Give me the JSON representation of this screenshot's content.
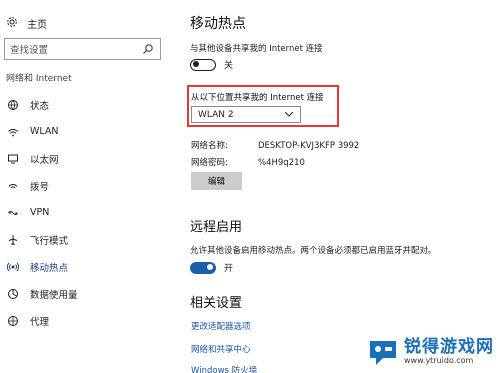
{
  "sidebar": {
    "home_label": "主页",
    "search_placeholder": "查找设置",
    "section_title": "网络和 Internet",
    "items": [
      {
        "label": "状态",
        "icon": "globe-status-icon",
        "active": false
      },
      {
        "label": "WLAN",
        "icon": "wifi-icon",
        "active": false
      },
      {
        "label": "以太网",
        "icon": "ethernet-monitor-icon",
        "active": false
      },
      {
        "label": "拨号",
        "icon": "dialup-icon",
        "active": false
      },
      {
        "label": "VPN",
        "icon": "vpn-icon",
        "active": false
      },
      {
        "label": "飞行模式",
        "icon": "airplane-icon",
        "active": false
      },
      {
        "label": "移动热点",
        "icon": "hotspot-icon",
        "active": true
      },
      {
        "label": "数据使用量",
        "icon": "data-usage-icon",
        "active": false
      },
      {
        "label": "代理",
        "icon": "proxy-globe-icon",
        "active": false
      }
    ]
  },
  "main": {
    "title": "移动热点",
    "share_desc": "与其他设备共享我的 Internet 连接",
    "hotspot_toggle_label": "关",
    "hotspot_toggle_on": false,
    "share_from_label": "从以下位置共享我的 Internet 连接",
    "share_from_value": "WLAN 2",
    "network_name_key": "网络名称:",
    "network_name_value": "DESKTOP-KVJ3KFP 3992",
    "network_password_key": "网络密码:",
    "network_password_value": "%4H9q210",
    "edit_label": "编辑",
    "remote_title": "远程启用",
    "remote_desc": "允许其他设备启用移动热点。两个设备必须都已启用蓝牙并配对。",
    "remote_toggle_label": "开",
    "remote_toggle_on": true,
    "related_title": "相关设置",
    "links": [
      "更改适配器选项",
      "网络和共享中心",
      "Windows 防火墙"
    ]
  },
  "watermark": {
    "title": "锐得游戏网",
    "url": "www.ytruido.com"
  },
  "colors": {
    "accent": "#1a5ea8",
    "link": "#1a56a8",
    "highlight_box": "#e53935",
    "watermark": "#1a6fb8"
  }
}
